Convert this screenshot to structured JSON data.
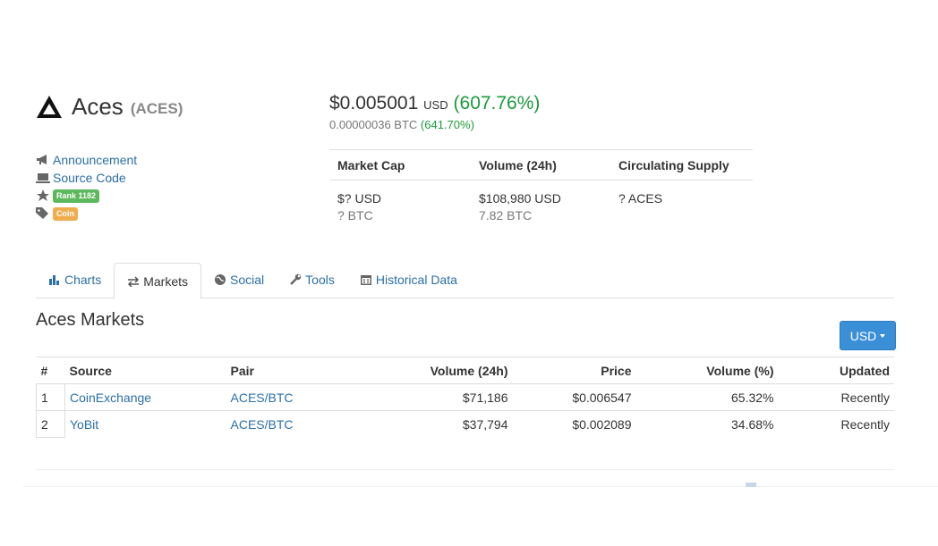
{
  "coin": {
    "name": "Aces",
    "symbol": "(ACES)",
    "logo_icon": "triangle-logo-icon"
  },
  "price": {
    "usd": "$0.005001",
    "usd_label": "USD",
    "usd_change": "(607.76%)",
    "btc": "0.00000036 BTC",
    "btc_change": "(641.70%)"
  },
  "links": {
    "announcement": "Announcement",
    "source_code": "Source Code",
    "rank": "Rank 1182",
    "type": "Coin"
  },
  "stats": {
    "headers": [
      "Market Cap",
      "Volume (24h)",
      "Circulating Supply"
    ],
    "market_cap_usd": "$? USD",
    "market_cap_btc": "? BTC",
    "volume_usd": "$108,980 USD",
    "volume_btc": "7.82 BTC",
    "supply": "? ACES"
  },
  "tabs": [
    {
      "label": "Charts",
      "icon": "bar-chart-icon"
    },
    {
      "label": "Markets",
      "icon": "exchange-arrows-icon"
    },
    {
      "label": "Social",
      "icon": "globe-icon"
    },
    {
      "label": "Tools",
      "icon": "wrench-icon"
    },
    {
      "label": "Historical Data",
      "icon": "calendar-icon"
    }
  ],
  "markets": {
    "title": "Aces Markets",
    "currency_button": "USD",
    "columns": [
      "#",
      "Source",
      "Pair",
      "Volume (24h)",
      "Price",
      "Volume (%)",
      "Updated"
    ],
    "rows": [
      {
        "num": "1",
        "source": "CoinExchange",
        "pair": "ACES/BTC",
        "volume": "$71,186",
        "price": "$0.006547",
        "volume_pct": "65.32%",
        "updated": "Recently"
      },
      {
        "num": "2",
        "source": "YoBit",
        "pair": "ACES/BTC",
        "volume": "$37,794",
        "price": "$0.002089",
        "volume_pct": "34.68%",
        "updated": "Recently"
      }
    ]
  },
  "colors": {
    "link": "#2a6fa8",
    "positive": "#1a9c3a",
    "button": "#3b8fd6",
    "rank_badge": "#5cb85c",
    "type_badge": "#f0ad4e"
  }
}
